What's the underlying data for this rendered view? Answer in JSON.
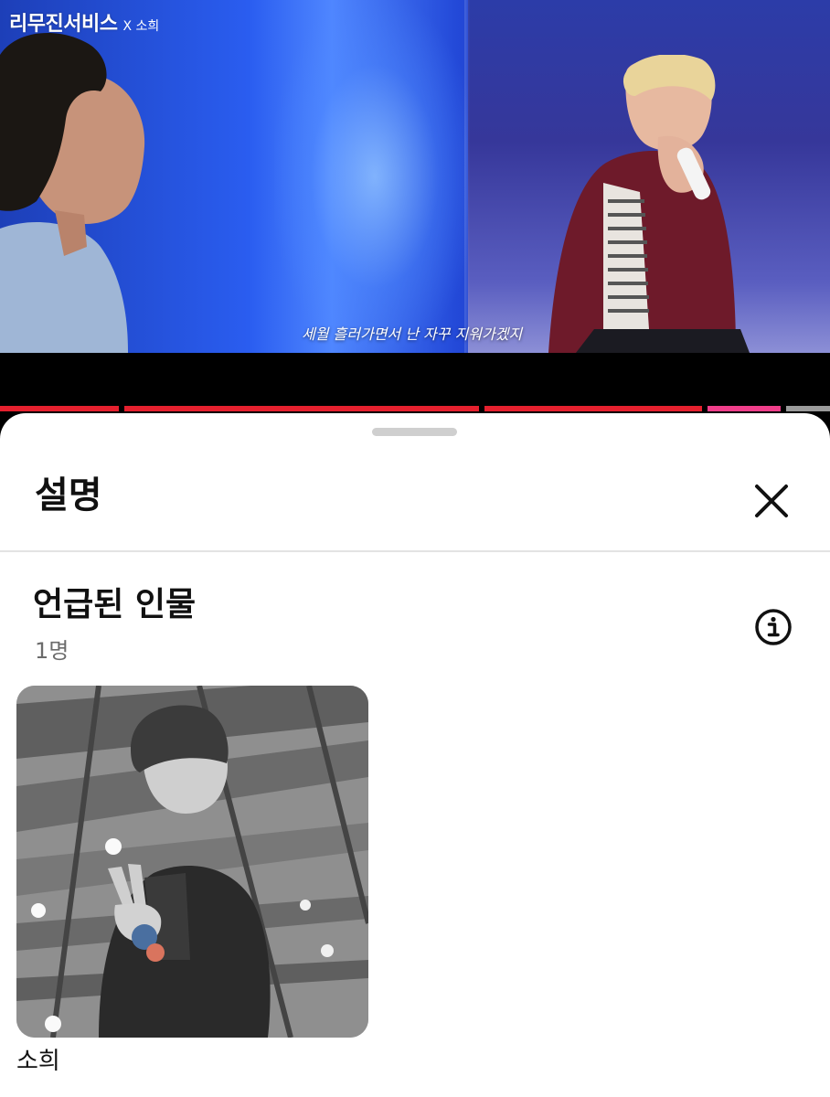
{
  "video": {
    "brand_logo": "리무진서비스",
    "brand_collab": "X 소희",
    "subtitle": "세월 흘러가면서 난 자꾸 지워가겠지"
  },
  "sheet": {
    "title": "설명",
    "close_icon": "close-icon"
  },
  "mentioned": {
    "title": "언급된 인물",
    "count": "1명",
    "info_icon": "info-icon",
    "people": [
      {
        "name": "소희"
      }
    ]
  },
  "colors": {
    "progress": "#e5202e",
    "sheet_bg": "#ffffff",
    "text_primary": "#111111",
    "text_secondary": "#6b6b6b"
  }
}
